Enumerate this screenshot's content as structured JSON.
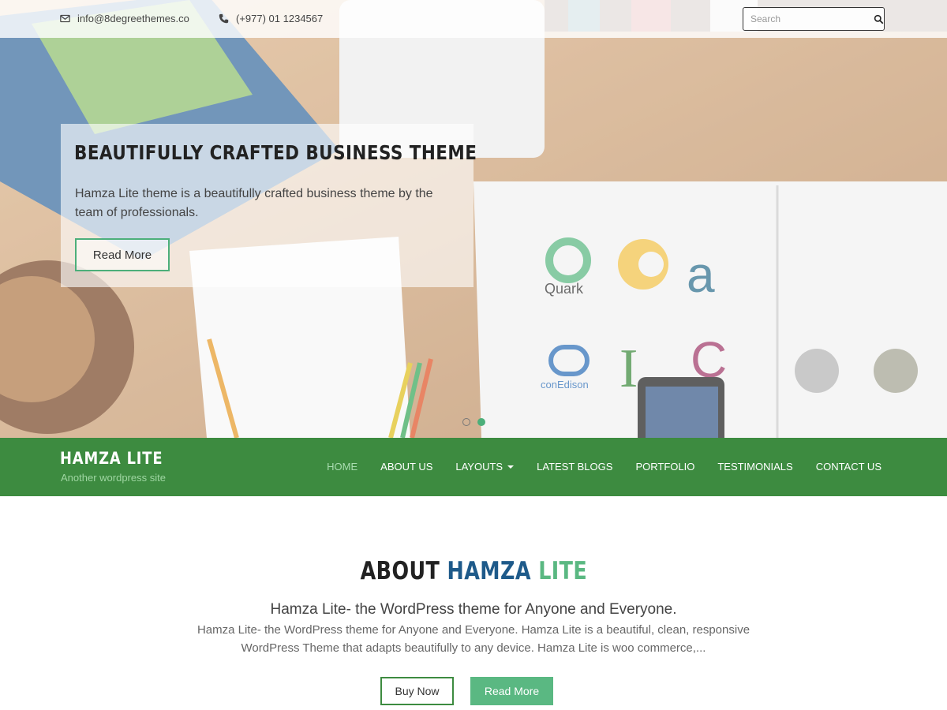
{
  "topbar": {
    "email": "info@8degreethemes.co",
    "phone": "(+977) 01 1234567",
    "search_placeholder": "Search"
  },
  "slider": {
    "title": "BEAUTIFULLY CRAFTED BUSINESS THEME",
    "text": "Hamza Lite theme is a beautifully crafted business theme by the team of professionals.",
    "button_label": "Read More",
    "slide_count": 2,
    "active_slide": 2
  },
  "header": {
    "site_title": "HAMZA LITE",
    "tagline": "Another wordpress site"
  },
  "menu": {
    "items": [
      {
        "label": "HOME"
      },
      {
        "label": "ABOUT US"
      },
      {
        "label": "LAYOUTS"
      },
      {
        "label": "LATEST BLOGS"
      },
      {
        "label": "PORTFOLIO"
      },
      {
        "label": "TESTIMONIALS"
      },
      {
        "label": "CONTACT US"
      }
    ]
  },
  "about": {
    "title_part1": "ABOUT",
    "title_part2": "HAMZA",
    "title_part3": "LITE",
    "subtitle": "Hamza Lite- the WordPress theme for Anyone and Everyone.",
    "description": "Hamza Lite- the WordPress theme for Anyone and Everyone. Hamza Lite is a beautiful, clean, responsive WordPress Theme that adapts beautifully to any device. Hamza Lite is woo commerce,...",
    "buy_label": "Buy Now",
    "read_label": "Read More"
  },
  "colors": {
    "brand_green": "#3d8b40",
    "accent_green": "#5ab882",
    "title_blue": "#1e5a8a"
  }
}
